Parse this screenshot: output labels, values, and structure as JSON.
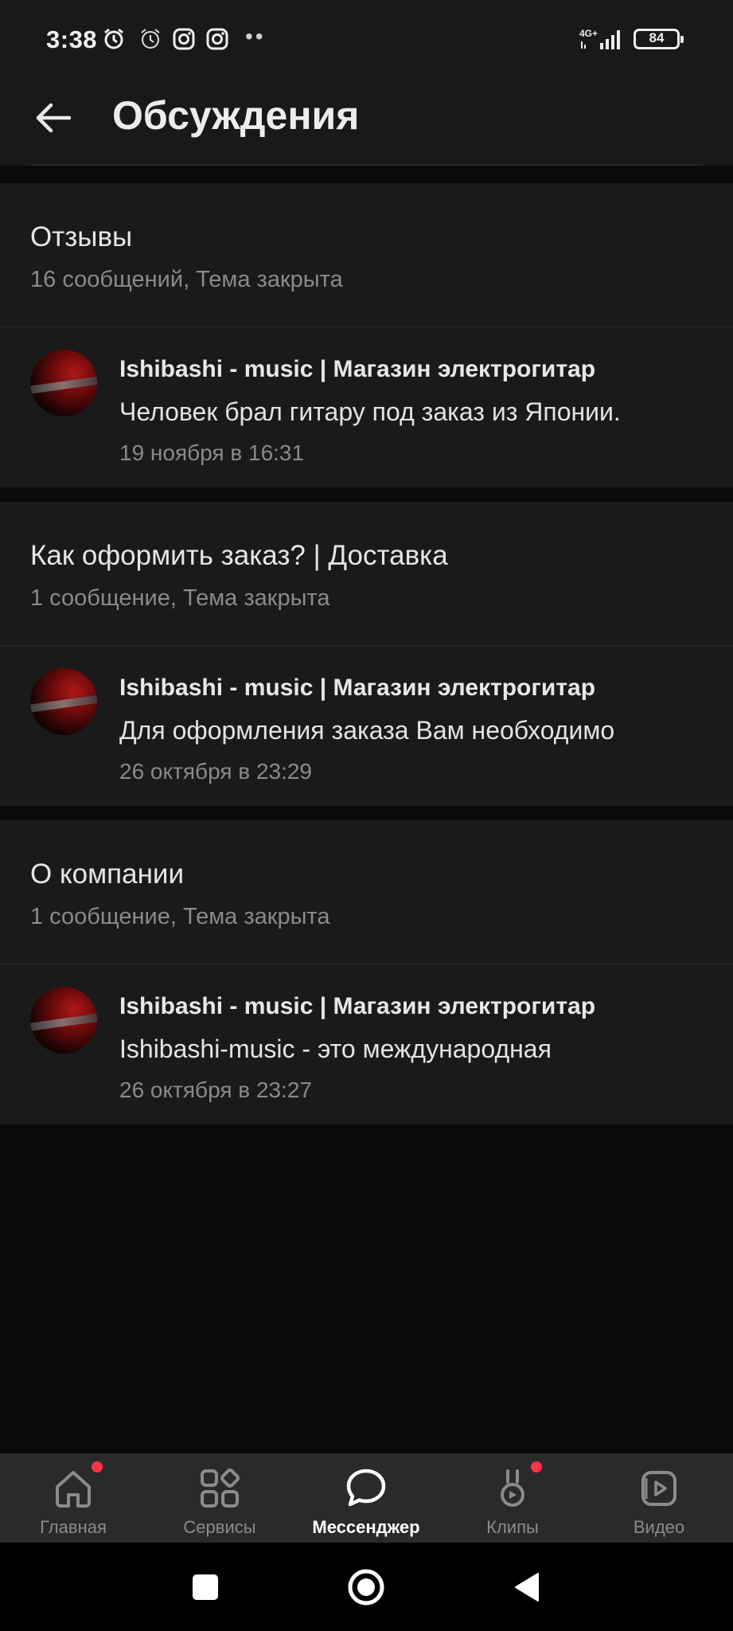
{
  "status_bar": {
    "time": "3:38",
    "network": "4G+",
    "battery": "84",
    "icons": [
      "alarm-icon",
      "alarm-outline-icon",
      "instagram-icon",
      "instagram-icon",
      "more-dots-icon"
    ]
  },
  "header": {
    "title": "Обсуждения",
    "back_icon": "arrow-left-icon"
  },
  "topics": [
    {
      "title": "Отзывы",
      "meta": "16 сообщений, Тема закрыта",
      "last_message": {
        "author": "Ishibashi - music | Магазин электрогитар",
        "text": "Человек брал гитару под заказ из Японии.",
        "date": "19 ноября в 16:31"
      }
    },
    {
      "title": "Как оформить заказ? | Доставка",
      "meta": "1 сообщение, Тема закрыта",
      "last_message": {
        "author": "Ishibashi - music | Магазин электрогитар",
        "text": "Для оформления заказа Вам необходимо",
        "date": "26 октября в 23:29"
      }
    },
    {
      "title": "О компании",
      "meta": "1 сообщение, Тема закрыта",
      "last_message": {
        "author": "Ishibashi - music | Магазин электрогитар",
        "text": "Ishibashi-music - это международная",
        "date": "26 октября в 23:27"
      }
    }
  ],
  "bottom_nav": {
    "items": [
      {
        "label": "Главная",
        "icon": "home-icon",
        "badge": true
      },
      {
        "label": "Сервисы",
        "icon": "grid-icon",
        "badge": false
      },
      {
        "label": "Мессенджер",
        "icon": "chat-bubble-icon",
        "badge": false,
        "active": true
      },
      {
        "label": "Клипы",
        "icon": "clips-icon",
        "badge": true
      },
      {
        "label": "Видео",
        "icon": "video-icon",
        "badge": false
      }
    ],
    "badge_color": "#ff3347"
  },
  "system_nav": {
    "buttons": [
      "recents-button",
      "home-button",
      "back-button"
    ]
  }
}
